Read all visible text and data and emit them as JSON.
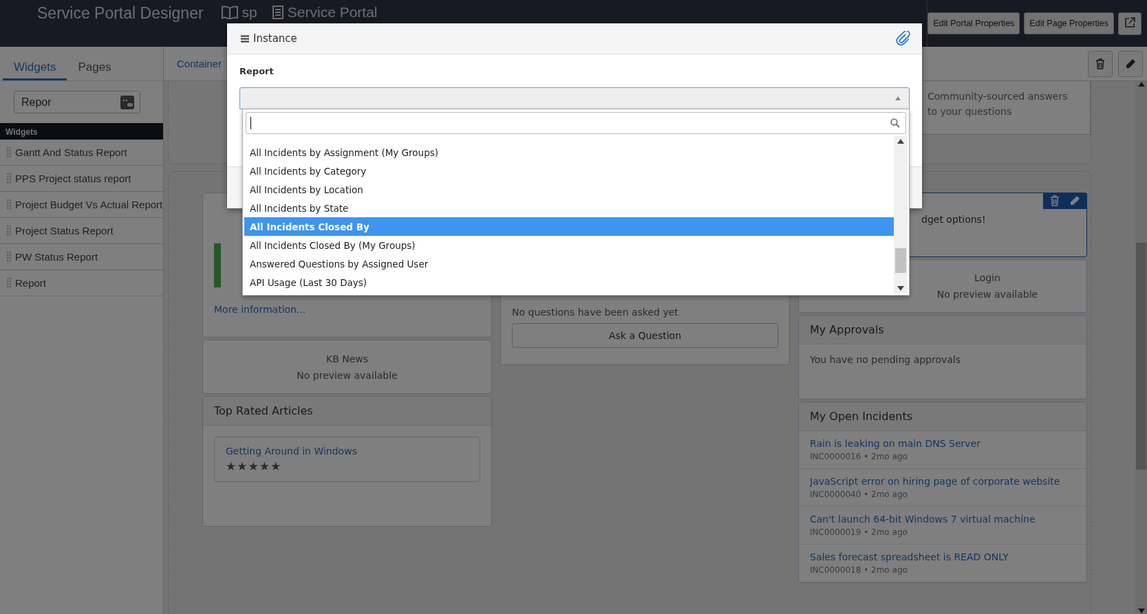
{
  "header": {
    "title": "Service Portal Designer",
    "portal_id": "sp",
    "portal_name": "Service Portal",
    "buttons": [
      "Edit Portal Properties",
      "Edit Page Properties"
    ]
  },
  "sidebar": {
    "tabs": [
      {
        "label": "Widgets",
        "selected": true
      },
      {
        "label": "Pages",
        "selected": false
      }
    ],
    "search": {
      "value": "Repor"
    },
    "section": "Widgets",
    "items": [
      "Gantt And Status Report",
      "PPS Project status report",
      "Project Budget Vs Actual Report",
      "Project Status Report",
      "PW Status Report",
      "Report"
    ]
  },
  "editor": {
    "breadcrumb": "Container",
    "top_card": {
      "text": "Community-sourced answers to your questions"
    },
    "left_column": {
      "link": "More information...",
      "kb_news": {
        "title": "KB News",
        "text": "No preview available"
      },
      "top_rated": {
        "title": "Top Rated Articles",
        "article": {
          "title": "Getting Around in Windows",
          "stars": 5
        }
      }
    },
    "middle_column": {
      "text": "No questions have been asked yet",
      "button": "Ask a Question"
    },
    "right_column": {
      "widget_text": "dget options!",
      "login": {
        "title": "Login",
        "text": "No preview available"
      },
      "approvals": {
        "title": "My Approvals",
        "text": "You have no pending approvals"
      },
      "incidents": {
        "title": "My Open Incidents",
        "items": [
          {
            "title": "Rain is leaking on main DNS Server",
            "meta": "INC0000016 • 2mo ago"
          },
          {
            "title": "JavaScript error on hiring page of corporate website",
            "meta": "INC0000040 • 2mo ago"
          },
          {
            "title": "Can't launch 64-bit Windows 7 virtual machine",
            "meta": "INC0000019 • 2mo ago"
          },
          {
            "title": "Sales forecast spreadsheet is READ ONLY",
            "meta": "INC0000018 • 2mo ago"
          }
        ]
      }
    }
  },
  "modal": {
    "title": "Instance",
    "field_label": "Report",
    "options": [
      {
        "label": "All Incidents by Assignment (My Groups)",
        "selected": false
      },
      {
        "label": "All Incidents by Category",
        "selected": false
      },
      {
        "label": "All Incidents by Location",
        "selected": false
      },
      {
        "label": "All Incidents by State",
        "selected": false
      },
      {
        "label": "All Incidents Closed By",
        "selected": true
      },
      {
        "label": "All Incidents Closed By (My Groups)",
        "selected": false
      },
      {
        "label": "Answered Questions by Assigned User",
        "selected": false
      },
      {
        "label": "API Usage (Last 30 Days)",
        "selected": false
      }
    ]
  }
}
